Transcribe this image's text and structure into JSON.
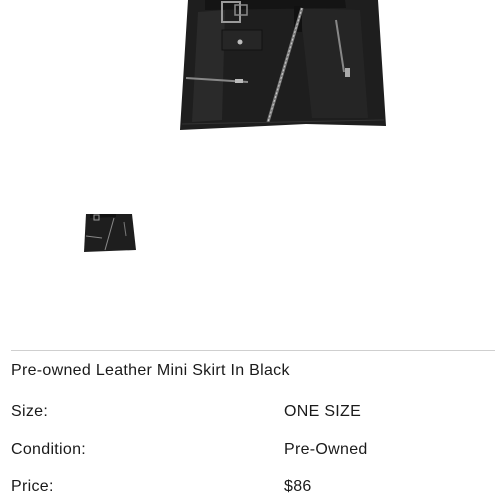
{
  "product": {
    "title": "Pre-owned Leather Mini Skirt In Black",
    "colors": {
      "leather": "#1e1e1e",
      "divider": "#cfcfcf",
      "text": "#1a1a1a"
    }
  },
  "details": [
    {
      "label": "Size:",
      "value": "ONE SIZE"
    },
    {
      "label": "Condition:",
      "value": "Pre-Owned"
    },
    {
      "label": "Price:",
      "value": "$86"
    }
  ]
}
